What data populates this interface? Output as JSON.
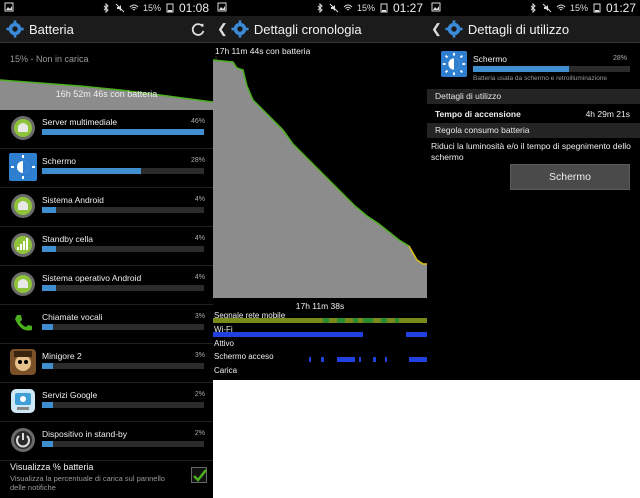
{
  "status_bars": [
    {
      "battery": "15%",
      "time": "01:08"
    },
    {
      "battery": "15%",
      "time": "01:27"
    },
    {
      "battery": "15%",
      "time": "01:27"
    }
  ],
  "battery_screen": {
    "title": "Batteria",
    "charge_status": "15% - Non in carica",
    "graph_label": "16h 52m 46s con batteria",
    "apps": [
      {
        "name": "Server multimediale",
        "percent": "46%",
        "level": 0.46,
        "icon": "media-server-icon"
      },
      {
        "name": "Schermo",
        "percent": "28%",
        "level": 0.28,
        "icon": "screen-brightness-icon"
      },
      {
        "name": "Sistema Android",
        "percent": "4%",
        "level": 0.04,
        "icon": "android-system-icon"
      },
      {
        "name": "Standby cella",
        "percent": "4%",
        "level": 0.04,
        "icon": "cell-standby-icon"
      },
      {
        "name": "Sistema operativo Android",
        "percent": "4%",
        "level": 0.04,
        "icon": "android-os-icon"
      },
      {
        "name": "Chiamate vocali",
        "percent": "3%",
        "level": 0.03,
        "icon": "phone-call-icon"
      },
      {
        "name": "Minigore 2",
        "percent": "3%",
        "level": 0.03,
        "icon": "minigore-game-icon"
      },
      {
        "name": "Servizi Google",
        "percent": "2%",
        "level": 0.02,
        "icon": "google-services-icon"
      },
      {
        "name": "Dispositivo in stand-by",
        "percent": "2%",
        "level": 0.02,
        "icon": "device-standby-icon"
      }
    ],
    "footer_title": "Visualizza % batteria",
    "footer_subtitle": "Visualizza la percentuale di carica sul pannello delle notifiche",
    "show_percent_checked": true
  },
  "history_screen": {
    "title": "Dettagli cronologia",
    "header": "17h 11m 44s con batteria",
    "time_label": "17h 11m 38s",
    "signal_labels": {
      "mobile": "Segnale rete mobile",
      "wifi": "Wi-Fi",
      "awake": "Attivo",
      "screen_on": "Schermo acceso",
      "charging": "Carica"
    }
  },
  "usage_screen": {
    "title": "Dettagli di utilizzo",
    "app_name": "Schermo",
    "app_percent": "28%",
    "app_level": 0.28,
    "app_description": "Batteria usata da schermo e retroilluminazione",
    "section_details": "Dettagli di utilizzo",
    "on_time_label": "Tempo di accensione",
    "on_time_value": "4h 29m 21s",
    "section_regulate": "Regola consumo batteria",
    "regulate_text": "Riduci la luminosità e/o il tempo di spegnimento dello schermo",
    "button_label": "Schermo"
  },
  "colors": {
    "bar_blue": "#3f8ed0",
    "graph_fill": "#8c8c8c",
    "graph_line": "#4caf1e",
    "wifi_blue": "#2140e0",
    "title_bar": "#1b1b1b"
  }
}
